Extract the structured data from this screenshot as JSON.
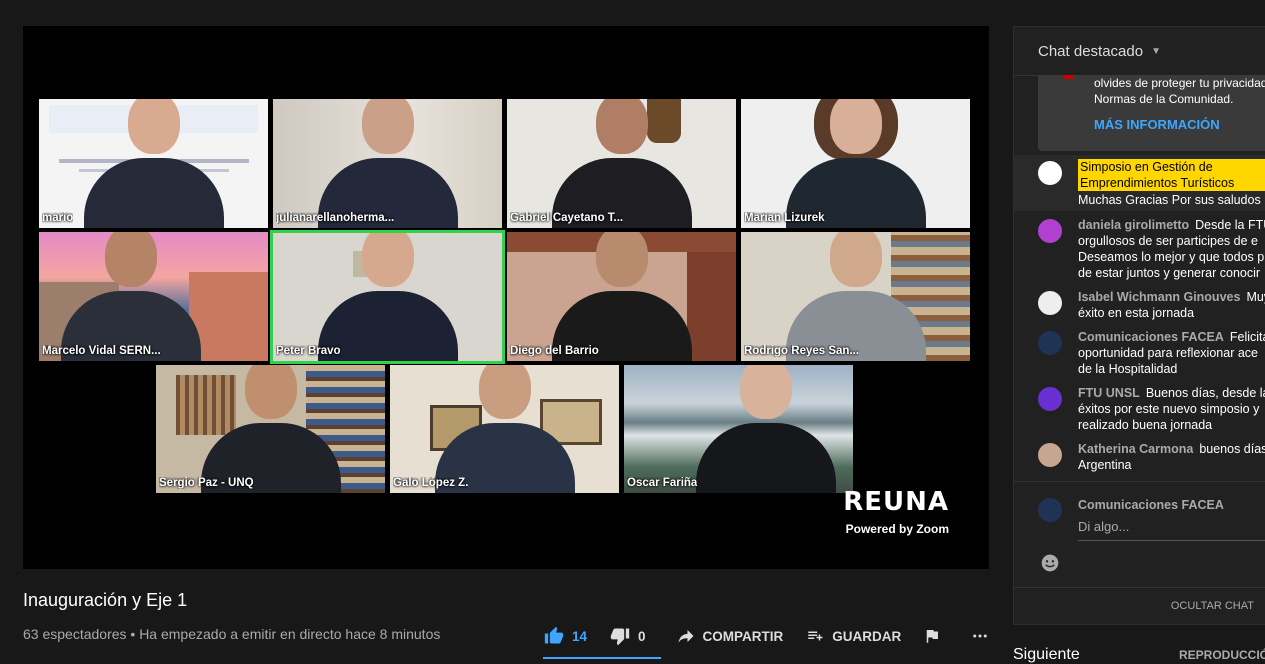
{
  "video": {
    "title": "Inauguración y Eje 1",
    "meta": "63 espectadores • Ha empezado a emitir en directo hace 8 minutos",
    "logo": "REUNA",
    "powered": "Powered by Zoom",
    "participants": [
      {
        "name": "mario"
      },
      {
        "name": "julianarellanoherma..."
      },
      {
        "name": "Gabriel Cayetano T..."
      },
      {
        "name": "Marian Lizurek"
      },
      {
        "name": "Marcelo Vidal SERN..."
      },
      {
        "name": "Peter Bravo"
      },
      {
        "name": "Diego del Barrio"
      },
      {
        "name": "Rodrigo Reyes San..."
      },
      {
        "name": "Sergio Paz - UNQ"
      },
      {
        "name": "Galo López Z."
      },
      {
        "name": "Oscar Fariña"
      }
    ]
  },
  "actions": {
    "likes": "14",
    "dislikes": "0",
    "share": "COMPARTIR",
    "save": "GUARDAR"
  },
  "chat": {
    "header": "Chat destacado",
    "banner_line1": "olvides de proteger tu privacidad",
    "banner_line2": "Normas de la Comunidad.",
    "banner_more": "MÁS INFORMACIÓN",
    "pinned_highlight": "Simposio en Gestión de Emprendimientos Turísticos",
    "pinned_text": "Muchas Gracias Por sus saludos",
    "messages": [
      {
        "author": "daniela girolimetto",
        "text": "Desde la FTU",
        "lines": [
          "orgullosos de ser participes de e",
          "Deseamos lo mejor y que todos p",
          "de estar juntos y generar conocir"
        ]
      },
      {
        "author": "Isabel Wichmann Ginouves",
        "text": "Muy",
        "lines": [
          "éxito en esta jornada"
        ]
      },
      {
        "author": "Comunicaciones FACEA",
        "text": "Felicita",
        "lines": [
          "oportunidad para reflexionar ace",
          "de la Hospitalidad"
        ]
      },
      {
        "author": "FTU UNSL",
        "text": "Buenos días, desde la",
        "lines": [
          "éxitos por este nuevo simposio y",
          "realizado buena jornada"
        ]
      },
      {
        "author": "Katherina Carmona",
        "text": "buenos días",
        "lines": [
          "Argentina"
        ]
      }
    ],
    "input_author": "Comunicaciones FACEA",
    "input_placeholder": "Di algo...",
    "hide": "OCULTAR CHAT"
  },
  "sidebar": {
    "next": "Siguiente",
    "autoplay": "REPRODUCCIÓ"
  }
}
